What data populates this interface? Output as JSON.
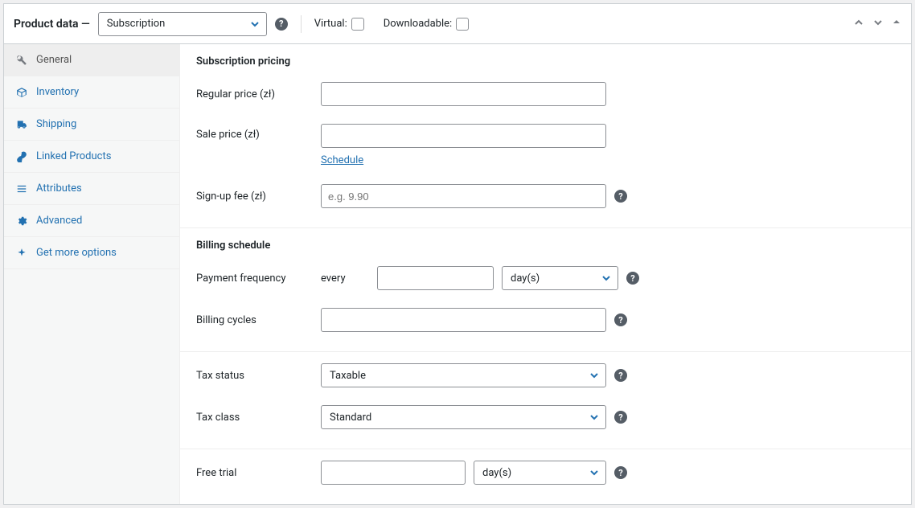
{
  "header": {
    "title": "Product data —",
    "product_type": "Subscription",
    "virtual_label": "Virtual:",
    "virtual_checked": false,
    "downloadable_label": "Downloadable:",
    "downloadable_checked": false
  },
  "tabs": [
    {
      "key": "general",
      "label": "General",
      "icon": "wrench",
      "active": true
    },
    {
      "key": "inventory",
      "label": "Inventory",
      "icon": "inventory"
    },
    {
      "key": "shipping",
      "label": "Shipping",
      "icon": "truck"
    },
    {
      "key": "linked",
      "label": "Linked Products",
      "icon": "link"
    },
    {
      "key": "attributes",
      "label": "Attributes",
      "icon": "list"
    },
    {
      "key": "advanced",
      "label": "Advanced",
      "icon": "gear"
    },
    {
      "key": "more",
      "label": "Get more options",
      "icon": "plus"
    }
  ],
  "sections": {
    "pricing": {
      "heading": "Subscription pricing",
      "regular_label": "Regular price (zł)",
      "regular_value": "",
      "sale_label": "Sale price (zł)",
      "sale_value": "",
      "schedule_label": "Schedule",
      "signup_label": "Sign-up fee (zł)",
      "signup_placeholder": "e.g. 9.90",
      "signup_value": ""
    },
    "billing": {
      "heading": "Billing schedule",
      "freq_label": "Payment frequency",
      "every_text": "every",
      "freq_value": "",
      "freq_unit": "day(s)",
      "cycles_label": "Billing cycles",
      "cycles_value": ""
    },
    "tax": {
      "status_label": "Tax status",
      "status_value": "Taxable",
      "class_label": "Tax class",
      "class_value": "Standard"
    },
    "trial": {
      "label": "Free trial",
      "value": "",
      "unit": "day(s)"
    }
  },
  "icons": {
    "wrench": "🔧",
    "inventory": "◈",
    "truck": "🚚",
    "link": "🔗",
    "list": "▤",
    "gear": "⚙",
    "plus": "✦"
  }
}
